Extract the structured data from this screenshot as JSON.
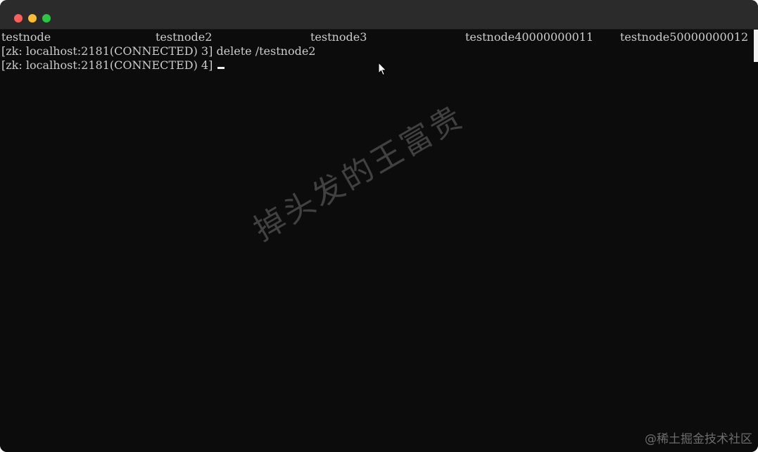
{
  "window": {
    "traffic_lights": [
      "close",
      "minimize",
      "maximize"
    ]
  },
  "terminal": {
    "ls_output": [
      "testnode",
      "testnode2",
      "testnode3",
      "testnode40000000011",
      "testnode50000000012"
    ],
    "line2": "[zk: localhost:2181(CONNECTED) 3] delete /testnode2",
    "line3_prompt": "[zk: localhost:2181(CONNECTED) 4] "
  },
  "watermark": "掉头发的王富贵",
  "credit": "@稀土掘金技术社区",
  "colors": {
    "background": "#0c0c0c",
    "text": "#cccccc",
    "titlebar": "#2b2b2b"
  }
}
